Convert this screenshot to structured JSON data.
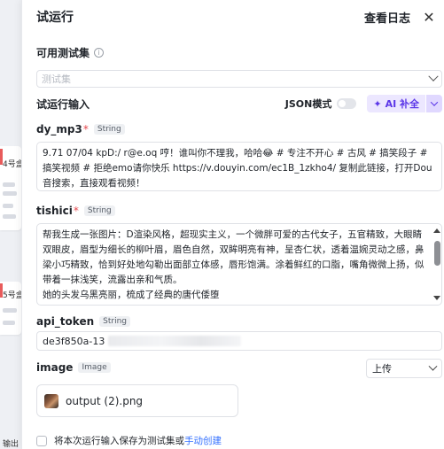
{
  "panel": {
    "title": "试运行",
    "view_log": "查看日志",
    "close_symbol": "✕"
  },
  "test_set": {
    "label": "可用测试集",
    "placeholder": "测试集"
  },
  "run_input": {
    "label": "试运行输入",
    "json_mode_label": "JSON模式",
    "json_mode_on": false,
    "ai_button_label": "AI 补全"
  },
  "fields": {
    "dy_mp3": {
      "name": "dy_mp3",
      "required": true,
      "type": "String",
      "value": "9.71 07/04 kpD:/ r@e.oq 哼！谁叫你不理我，哈哈😂 # 专注不开心 # 古风 # 搞笑段子 # 搞笑视频 # 拒绝emo请你快乐  https://v.douyin.com/ec1B_1zkho4/ 复制此链接，打开Dou音搜索，直接观看视频！"
    },
    "tishici": {
      "name": "tishici",
      "required": true,
      "type": "String",
      "value_lines": [
        "帮我生成一张图片：D渲染风格，超现实主义，一个微胖可爱的古代女子，五官精致，大眼睛双眼皮，眉型为细长的柳叶眉，眉色自然，双眸明亮有神，呈杏仁状，透着温婉灵动之感，鼻梁小巧精致，恰到好处地勾勒出面部立体感，唇形饱满。涂着鲜红的口脂，嘴角微微上扬，似带着一抹浅笑，流露出亲和气质。",
        "她的头发乌黑亮丽，梳成了经典的唐代倭堕"
      ]
    },
    "api_token": {
      "name": "api_token",
      "required": false,
      "type": "String",
      "value_visible": "de3f850a-13"
    },
    "image": {
      "name": "image",
      "required": false,
      "type": "Image",
      "upload_mode": "上传",
      "file_name": "output (2).png"
    }
  },
  "footer": {
    "save_text": "将本次运行输入保存为测试集或",
    "manual_create_link": "手动创建",
    "save_checked": false
  },
  "background": {
    "labels": [
      "4号盒",
      "5号盒",
      "输出"
    ]
  }
}
